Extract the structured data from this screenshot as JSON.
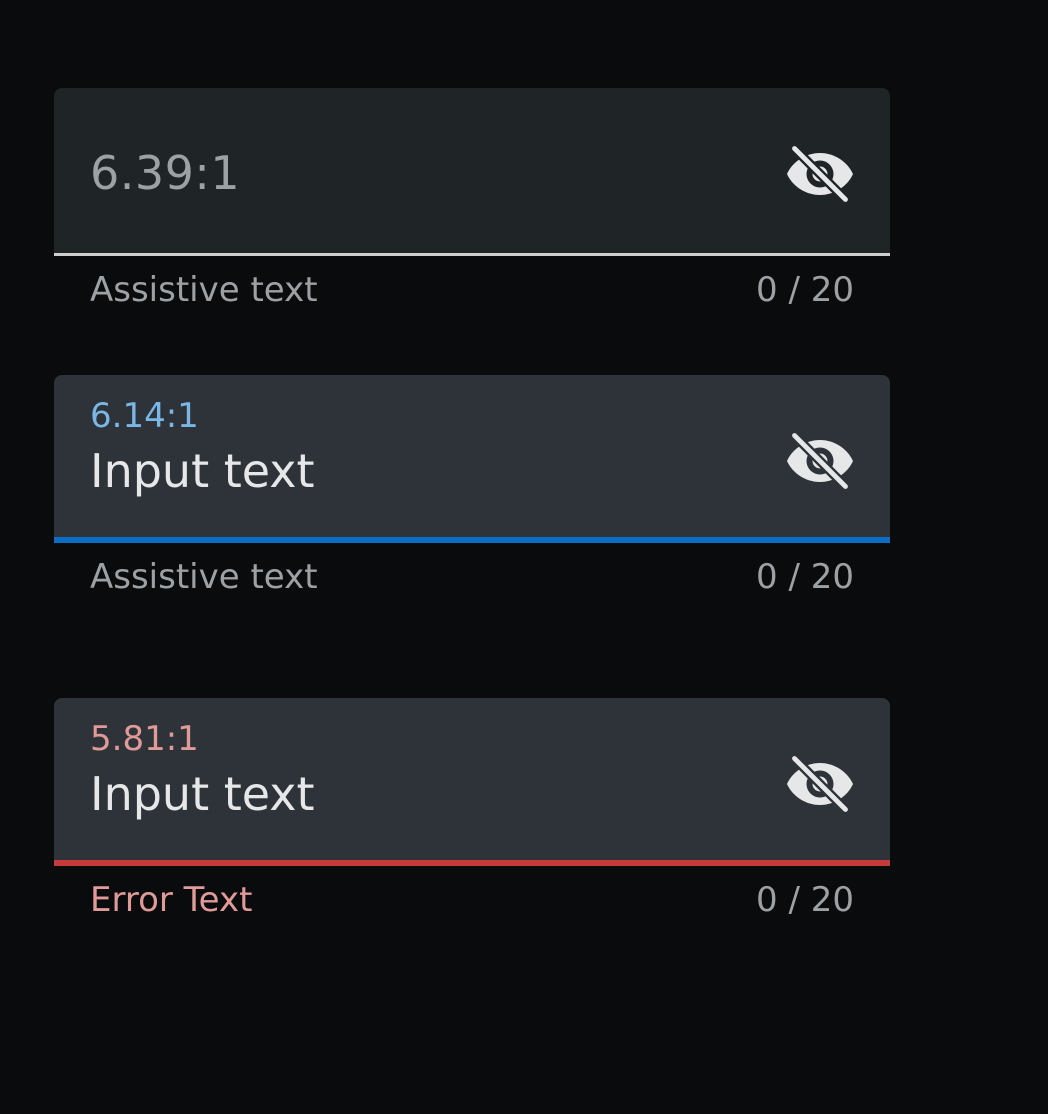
{
  "fields": [
    {
      "placeholder": "6.39:1",
      "helper": "Assistive text",
      "counter": "0 / 20",
      "icon": "visibility-off-icon",
      "state": "enabled"
    },
    {
      "label": "6.14:1",
      "value": "Input text",
      "helper": "Assistive text",
      "counter": "0 / 20",
      "icon": "visibility-off-icon",
      "state": "focused",
      "accent": "#0a6ec4"
    },
    {
      "label": "5.81:1",
      "value": "Input text",
      "helper": "Error Text",
      "counter": "0 / 20",
      "icon": "visibility-off-icon",
      "state": "error",
      "accent": "#c73a3a"
    }
  ]
}
